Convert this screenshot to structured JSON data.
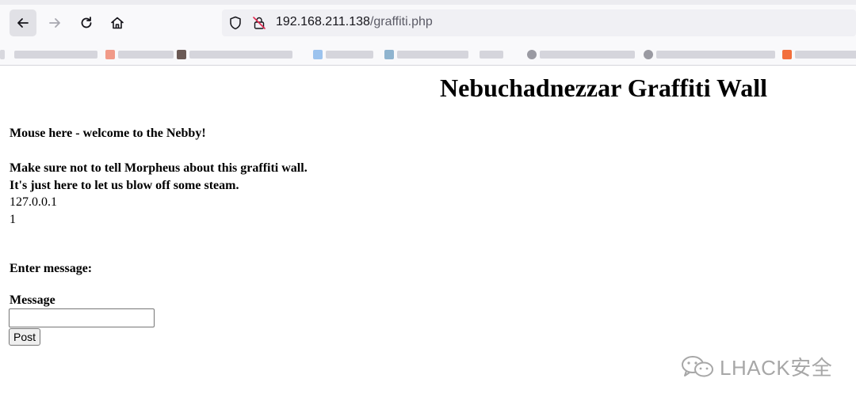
{
  "browser": {
    "url_host": "192.168.211.138",
    "url_path": "/graffiti.php",
    "icons": [
      "back-arrow-icon",
      "forward-arrow-icon",
      "reload-icon",
      "home-icon",
      "shield-icon",
      "insecure-lock-icon"
    ]
  },
  "page": {
    "title": "Nebuchadnezzar Graffiti Wall",
    "lines": [
      "Mouse here - welcome to the Nebby!",
      "Make sure not to tell Morpheus about this graffiti wall.",
      "It's just here to let us blow off some steam.",
      "127.0.0.1",
      "1"
    ],
    "form": {
      "heading": "Enter message:",
      "field_label": "Message",
      "message_value": "",
      "submit_label": "Post"
    }
  },
  "watermark": {
    "text": "LHACK安全"
  },
  "colors": {
    "chrome_bg": "#f9f9fb",
    "urlbar_bg": "#f0f0f4",
    "page_bg": "#ffffff"
  }
}
